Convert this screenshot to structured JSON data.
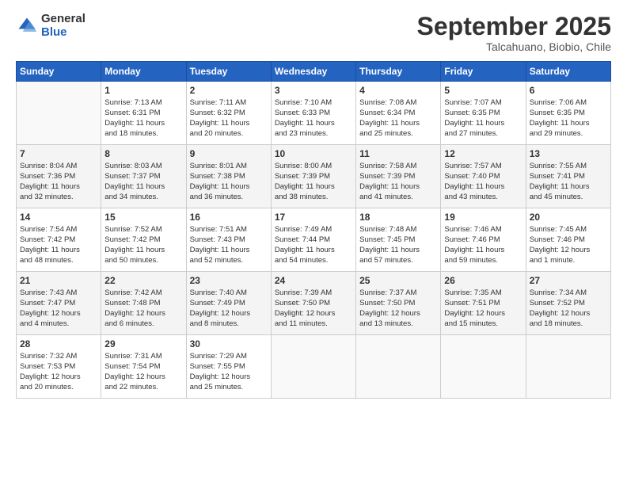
{
  "logo": {
    "general": "General",
    "blue": "Blue"
  },
  "header": {
    "month": "September 2025",
    "location": "Talcahuano, Biobio, Chile"
  },
  "weekdays": [
    "Sunday",
    "Monday",
    "Tuesday",
    "Wednesday",
    "Thursday",
    "Friday",
    "Saturday"
  ],
  "weeks": [
    [
      {
        "day": "",
        "info": ""
      },
      {
        "day": "1",
        "info": "Sunrise: 7:13 AM\nSunset: 6:31 PM\nDaylight: 11 hours\nand 18 minutes."
      },
      {
        "day": "2",
        "info": "Sunrise: 7:11 AM\nSunset: 6:32 PM\nDaylight: 11 hours\nand 20 minutes."
      },
      {
        "day": "3",
        "info": "Sunrise: 7:10 AM\nSunset: 6:33 PM\nDaylight: 11 hours\nand 23 minutes."
      },
      {
        "day": "4",
        "info": "Sunrise: 7:08 AM\nSunset: 6:34 PM\nDaylight: 11 hours\nand 25 minutes."
      },
      {
        "day": "5",
        "info": "Sunrise: 7:07 AM\nSunset: 6:35 PM\nDaylight: 11 hours\nand 27 minutes."
      },
      {
        "day": "6",
        "info": "Sunrise: 7:06 AM\nSunset: 6:35 PM\nDaylight: 11 hours\nand 29 minutes."
      }
    ],
    [
      {
        "day": "7",
        "info": "Sunrise: 8:04 AM\nSunset: 7:36 PM\nDaylight: 11 hours\nand 32 minutes."
      },
      {
        "day": "8",
        "info": "Sunrise: 8:03 AM\nSunset: 7:37 PM\nDaylight: 11 hours\nand 34 minutes."
      },
      {
        "day": "9",
        "info": "Sunrise: 8:01 AM\nSunset: 7:38 PM\nDaylight: 11 hours\nand 36 minutes."
      },
      {
        "day": "10",
        "info": "Sunrise: 8:00 AM\nSunset: 7:39 PM\nDaylight: 11 hours\nand 38 minutes."
      },
      {
        "day": "11",
        "info": "Sunrise: 7:58 AM\nSunset: 7:39 PM\nDaylight: 11 hours\nand 41 minutes."
      },
      {
        "day": "12",
        "info": "Sunrise: 7:57 AM\nSunset: 7:40 PM\nDaylight: 11 hours\nand 43 minutes."
      },
      {
        "day": "13",
        "info": "Sunrise: 7:55 AM\nSunset: 7:41 PM\nDaylight: 11 hours\nand 45 minutes."
      }
    ],
    [
      {
        "day": "14",
        "info": "Sunrise: 7:54 AM\nSunset: 7:42 PM\nDaylight: 11 hours\nand 48 minutes."
      },
      {
        "day": "15",
        "info": "Sunrise: 7:52 AM\nSunset: 7:42 PM\nDaylight: 11 hours\nand 50 minutes."
      },
      {
        "day": "16",
        "info": "Sunrise: 7:51 AM\nSunset: 7:43 PM\nDaylight: 11 hours\nand 52 minutes."
      },
      {
        "day": "17",
        "info": "Sunrise: 7:49 AM\nSunset: 7:44 PM\nDaylight: 11 hours\nand 54 minutes."
      },
      {
        "day": "18",
        "info": "Sunrise: 7:48 AM\nSunset: 7:45 PM\nDaylight: 11 hours\nand 57 minutes."
      },
      {
        "day": "19",
        "info": "Sunrise: 7:46 AM\nSunset: 7:46 PM\nDaylight: 11 hours\nand 59 minutes."
      },
      {
        "day": "20",
        "info": "Sunrise: 7:45 AM\nSunset: 7:46 PM\nDaylight: 12 hours\nand 1 minute."
      }
    ],
    [
      {
        "day": "21",
        "info": "Sunrise: 7:43 AM\nSunset: 7:47 PM\nDaylight: 12 hours\nand 4 minutes."
      },
      {
        "day": "22",
        "info": "Sunrise: 7:42 AM\nSunset: 7:48 PM\nDaylight: 12 hours\nand 6 minutes."
      },
      {
        "day": "23",
        "info": "Sunrise: 7:40 AM\nSunset: 7:49 PM\nDaylight: 12 hours\nand 8 minutes."
      },
      {
        "day": "24",
        "info": "Sunrise: 7:39 AM\nSunset: 7:50 PM\nDaylight: 12 hours\nand 11 minutes."
      },
      {
        "day": "25",
        "info": "Sunrise: 7:37 AM\nSunset: 7:50 PM\nDaylight: 12 hours\nand 13 minutes."
      },
      {
        "day": "26",
        "info": "Sunrise: 7:35 AM\nSunset: 7:51 PM\nDaylight: 12 hours\nand 15 minutes."
      },
      {
        "day": "27",
        "info": "Sunrise: 7:34 AM\nSunset: 7:52 PM\nDaylight: 12 hours\nand 18 minutes."
      }
    ],
    [
      {
        "day": "28",
        "info": "Sunrise: 7:32 AM\nSunset: 7:53 PM\nDaylight: 12 hours\nand 20 minutes."
      },
      {
        "day": "29",
        "info": "Sunrise: 7:31 AM\nSunset: 7:54 PM\nDaylight: 12 hours\nand 22 minutes."
      },
      {
        "day": "30",
        "info": "Sunrise: 7:29 AM\nSunset: 7:55 PM\nDaylight: 12 hours\nand 25 minutes."
      },
      {
        "day": "",
        "info": ""
      },
      {
        "day": "",
        "info": ""
      },
      {
        "day": "",
        "info": ""
      },
      {
        "day": "",
        "info": ""
      }
    ]
  ]
}
